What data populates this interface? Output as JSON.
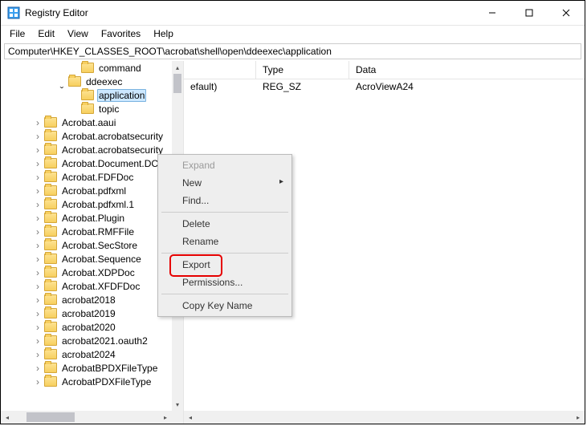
{
  "window": {
    "title": "Registry Editor"
  },
  "menu": {
    "file": "File",
    "edit": "Edit",
    "view": "View",
    "favorites": "Favorites",
    "help": "Help"
  },
  "address": "Computer\\HKEY_CLASSES_ROOT\\acrobat\\shell\\open\\ddeexec\\application",
  "tree": {
    "command": "command",
    "ddeexec": "ddeexec",
    "application": "application",
    "topic": "topic",
    "items": [
      "Acrobat.aaui",
      "Acrobat.acrobatsecurity",
      "Acrobat.acrobatsecurity",
      "Acrobat.Document.DC",
      "Acrobat.FDFDoc",
      "Acrobat.pdfxml",
      "Acrobat.pdfxml.1",
      "Acrobat.Plugin",
      "Acrobat.RMFFile",
      "Acrobat.SecStore",
      "Acrobat.Sequence",
      "Acrobat.XDPDoc",
      "Acrobat.XFDFDoc",
      "acrobat2018",
      "acrobat2019",
      "acrobat2020",
      "acrobat2021.oauth2",
      "acrobat2024",
      "AcrobatBPDXFileType",
      "AcrobatPDXFileType"
    ]
  },
  "columns": {
    "name": "",
    "type": "Type",
    "data": "Data"
  },
  "rows": [
    {
      "name": "efault)",
      "type": "REG_SZ",
      "data": "AcroViewA24"
    }
  ],
  "context": {
    "expand": "Expand",
    "new": "New",
    "find": "Find...",
    "delete": "Delete",
    "rename": "Rename",
    "export": "Export",
    "permissions": "Permissions...",
    "copykeyname": "Copy Key Name"
  }
}
